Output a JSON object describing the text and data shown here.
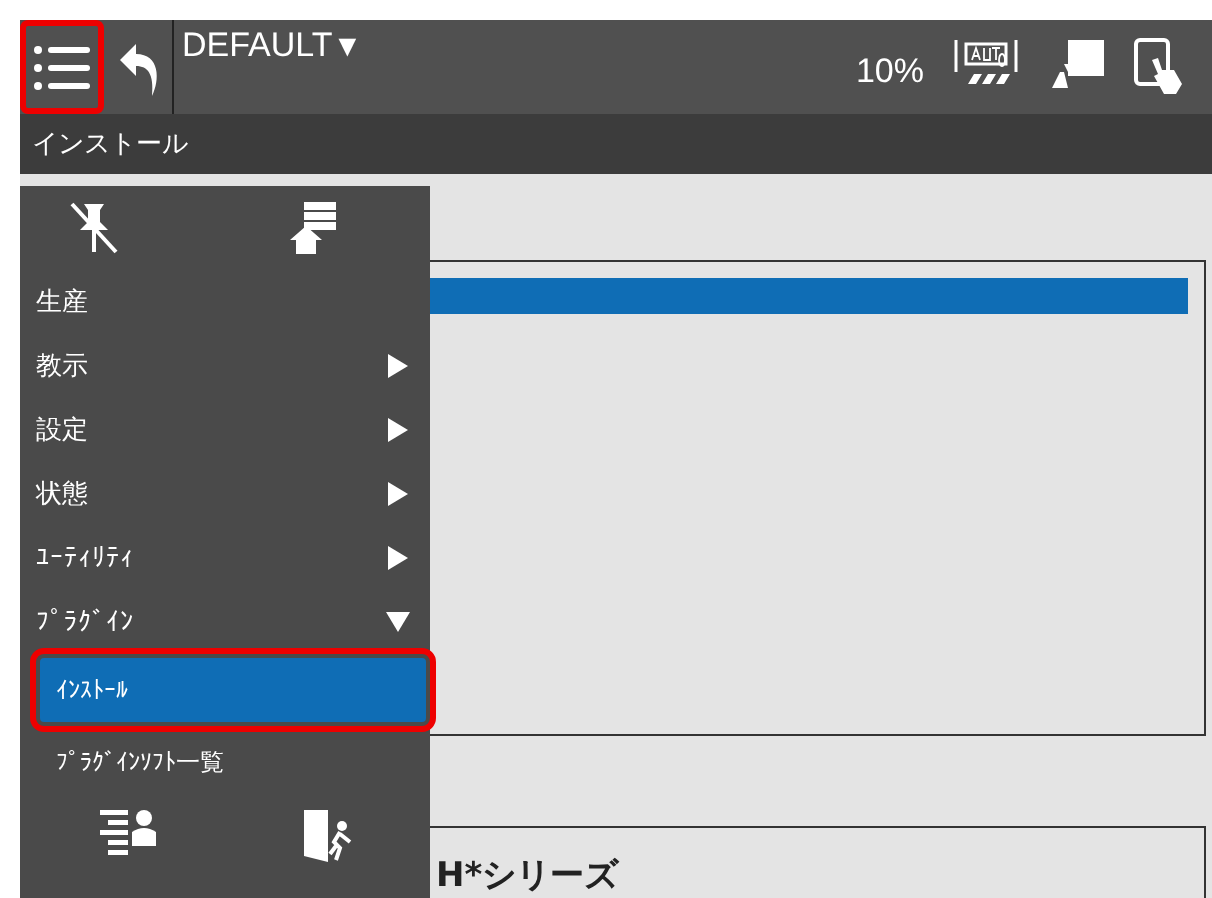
{
  "top_bar": {
    "title": "DEFAULT",
    "title_caret": "▼",
    "speed": "10%"
  },
  "page_title": "インストール",
  "content": {
    "files": [
      {
        "selected": true
      }
    ],
    "detail_text": "H*シリーズ"
  },
  "menu": {
    "items": [
      {
        "label": "生産",
        "kind": "item"
      },
      {
        "label": "教示",
        "kind": "submenu",
        "expanded": false
      },
      {
        "label": "設定",
        "kind": "submenu",
        "expanded": false
      },
      {
        "label": "状態",
        "kind": "submenu",
        "expanded": false
      },
      {
        "label": "ﾕｰﾃｨﾘﾃｨ",
        "kind": "submenu",
        "expanded": false
      },
      {
        "label": "ﾌﾟﾗｸﾞｲﾝ",
        "kind": "submenu",
        "expanded": true,
        "children": [
          {
            "label": "ｲﾝｽﾄｰﾙ",
            "selected": true
          },
          {
            "label": "ﾌﾟﾗｸﾞｲﾝｿﾌﾄ一覧",
            "selected": false
          }
        ]
      }
    ]
  }
}
